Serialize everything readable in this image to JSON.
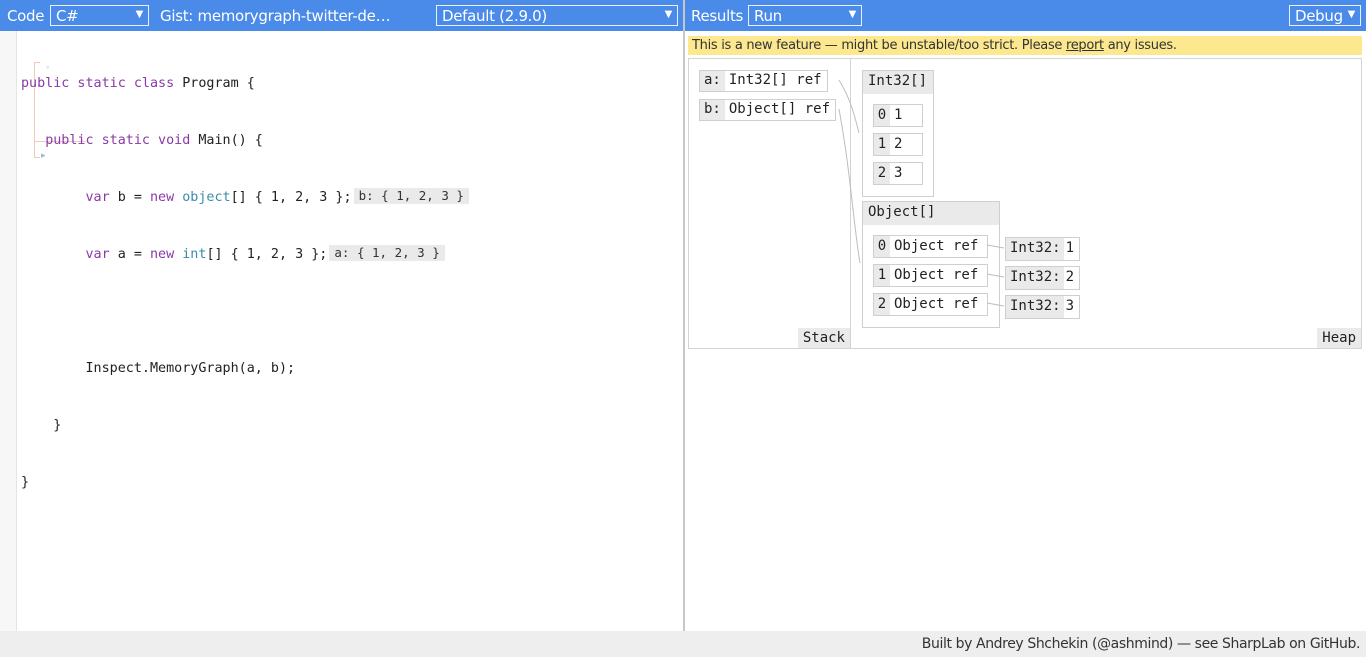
{
  "code_panel": {
    "title": "Code",
    "language_select": "C#",
    "gist_label": "Gist: memorygraph-twitter-de…",
    "branch_select": "Default (2.9.0)"
  },
  "results_panel": {
    "title": "Results",
    "mode_select": "Run",
    "build_select": "Debug"
  },
  "code": {
    "line1": {
      "kw": "public static class",
      "rest": " Program {"
    },
    "line2": {
      "kw": "public static void",
      "rest": " Main() {"
    },
    "line3": {
      "kw1": "var",
      "t1": " b = ",
      "kw2": "new",
      "ty": " object",
      "t2": "[] { 1, 2, 3 };",
      "inline": "b: { 1, 2, 3 }"
    },
    "line4": {
      "kw1": "var",
      "t1": " a = ",
      "kw2": "new",
      "ty": " int",
      "t2": "[] { 1, 2, 3 };",
      "inline": "a: { 1, 2, 3 }"
    },
    "line6": "Inspect.MemoryGraph(a, b);",
    "line7": "}",
    "line8": "}"
  },
  "warning": {
    "before": "This is a new feature — might be unstable/too strict. Please ",
    "link": "report",
    "after": " any issues."
  },
  "memory_graph": {
    "stack_label": "Stack",
    "heap_label": "Heap",
    "stack": [
      {
        "name": "a:",
        "value": "Int32[] ref"
      },
      {
        "name": "b:",
        "value": "Object[] ref"
      }
    ],
    "int_array": {
      "title": "Int32[]",
      "items": [
        {
          "index": "0",
          "value": "1"
        },
        {
          "index": "1",
          "value": "2"
        },
        {
          "index": "2",
          "value": "3"
        }
      ]
    },
    "object_array": {
      "title": "Object[]",
      "items": [
        {
          "index": "0",
          "value": "Object ref"
        },
        {
          "index": "1",
          "value": "Object ref"
        },
        {
          "index": "2",
          "value": "Object ref"
        }
      ]
    },
    "boxed": [
      {
        "type": "Int32:",
        "value": "1"
      },
      {
        "type": "Int32:",
        "value": "2"
      },
      {
        "type": "Int32:",
        "value": "3"
      }
    ]
  },
  "footer": "Built by Andrey Shchekin (@ashmind) — see SharpLab on GitHub."
}
